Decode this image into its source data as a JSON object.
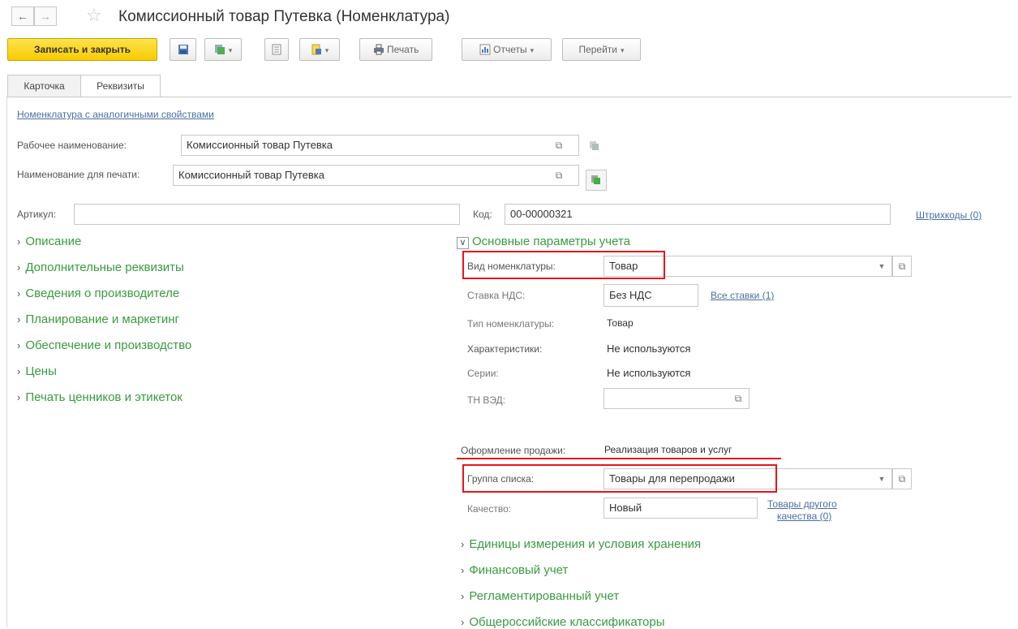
{
  "window": {
    "title": "Комиссионный товар Путевка (Номенклатура)",
    "back_icon": "←",
    "forward_icon": "→",
    "star_icon": "☆"
  },
  "toolbar": {
    "save_close": "Записать и закрыть",
    "print": "Печать",
    "reports": "Отчеты",
    "goto": "Перейти",
    "caret": "▼"
  },
  "tabs": [
    {
      "label": "Карточка",
      "active": false
    },
    {
      "label": "Реквизиты",
      "active": true
    }
  ],
  "similar_link": "Номенклатура с аналогичными свойствами",
  "fields": {
    "work_name": {
      "label": "Рабочее наименование:",
      "value": "Комиссионный товар Путевка"
    },
    "print_name": {
      "label": "Наименование для печати:",
      "value": "Комиссионный товар Путевка"
    },
    "article": {
      "label": "Артикул:",
      "value": ""
    },
    "code": {
      "label": "Код:",
      "value": "00-00000321"
    },
    "barcodes_link": "Штрихкоды (0)"
  },
  "left_groups": [
    "Описание",
    "Дополнительные реквизиты",
    "Сведения о производителе",
    "Планирование и маркетинг",
    "Обеспечение и производство",
    "Цены",
    "Печать ценников и этикеток"
  ],
  "main_params": {
    "title": "Основные параметры учета",
    "expand_icon": "∨",
    "collapsed_icon": "›",
    "kind": {
      "label": "Вид номенклатуры:",
      "value": "Товар"
    },
    "vat": {
      "label": "Ставка НДС:",
      "value": "Без НДС",
      "link": "Все ставки (1)"
    },
    "type": {
      "label": "Тип номенклатуры:",
      "value": "Товар"
    },
    "characteristics": {
      "label": "Характеристики:",
      "value": "Не используются"
    },
    "series": {
      "label": "Серии:",
      "value": "Не используются"
    },
    "tnved": {
      "label": "ТН ВЭД:",
      "value": ""
    },
    "sale": {
      "label": "Оформление продажи:",
      "value": "Реализация товаров и услуг"
    },
    "list_group": {
      "label": "Группа списка:",
      "value": "Товары для перепродажи"
    },
    "quality": {
      "label": "Качество:",
      "value": "Новый",
      "link_line1": "Товары другого",
      "link_line2": "качества (0)"
    }
  },
  "right_groups": [
    "Единицы измерения и условия хранения",
    "Финансовый учет",
    "Регламентированный учет",
    "Общероссийские классификаторы"
  ],
  "colors": {
    "accent_green": "#3a9b40",
    "highlight_red": "#e8141a",
    "primary_button": "#f8cb00",
    "link": "#4a6fa5"
  }
}
